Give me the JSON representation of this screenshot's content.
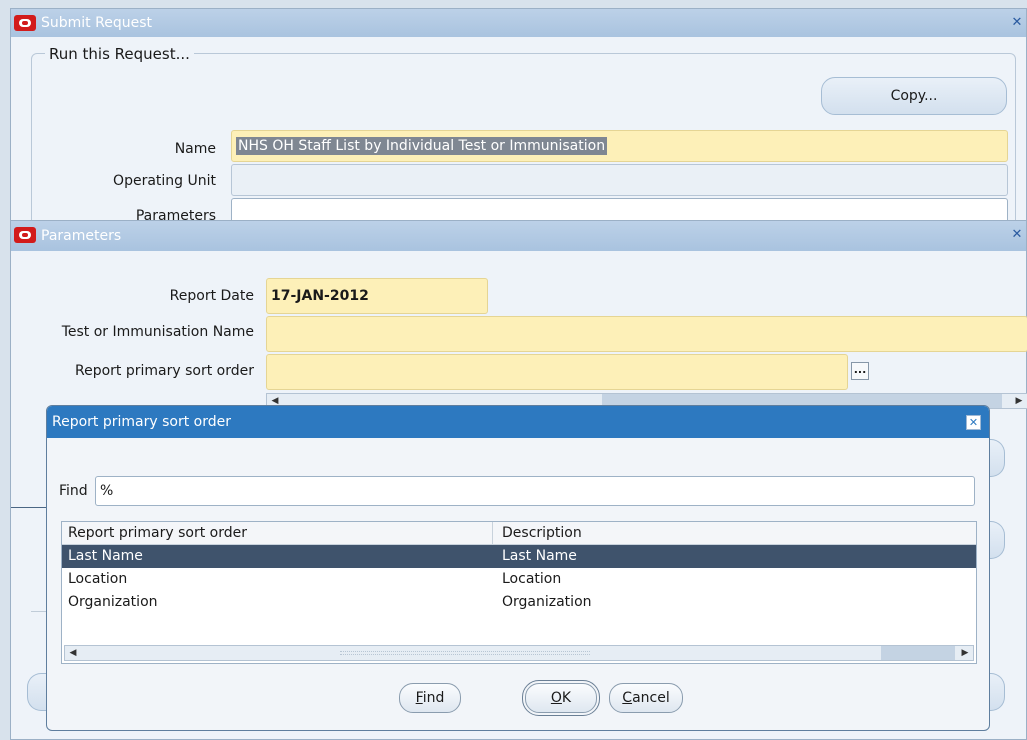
{
  "submit_request": {
    "title": "Submit Request",
    "group_label": "Run this Request...",
    "copy_button": "Copy...",
    "fields": {
      "name_label": "Name",
      "name_value": "NHS OH Staff List by Individual Test or Immunisation",
      "operating_unit_label": "Operating Unit",
      "operating_unit_value": "",
      "parameters_label": "Parameters",
      "parameters_value": ""
    }
  },
  "parameters": {
    "title": "Parameters",
    "report_date_label": "Report Date",
    "report_date_value": "17-JAN-2012",
    "test_name_label": "Test or Immunisation Name",
    "test_name_value": "",
    "sort_order_label": "Report primary sort order",
    "sort_order_value": "",
    "lov_button": "..."
  },
  "lov": {
    "title": "Report primary sort order",
    "find_label": "Find",
    "find_value": "%",
    "columns": [
      "Report primary sort order",
      "Description"
    ],
    "rows": [
      {
        "value": "Last Name",
        "description": "Last Name",
        "selected": true
      },
      {
        "value": "Location",
        "description": "Location",
        "selected": false
      },
      {
        "value": "Organization",
        "description": "Organization",
        "selected": false
      }
    ],
    "buttons": {
      "find": {
        "mnemonic": "F",
        "rest": "ind"
      },
      "ok": {
        "mnemonic": "O",
        "rest": "K"
      },
      "cancel": {
        "mnemonic": "C",
        "rest": "ancel"
      }
    }
  },
  "colors": {
    "required_field": "#fdf0b8",
    "selected_row": "#3f536c",
    "dialog_title_bar": "#2d79c0",
    "oracle_red": "#d21b1b"
  }
}
